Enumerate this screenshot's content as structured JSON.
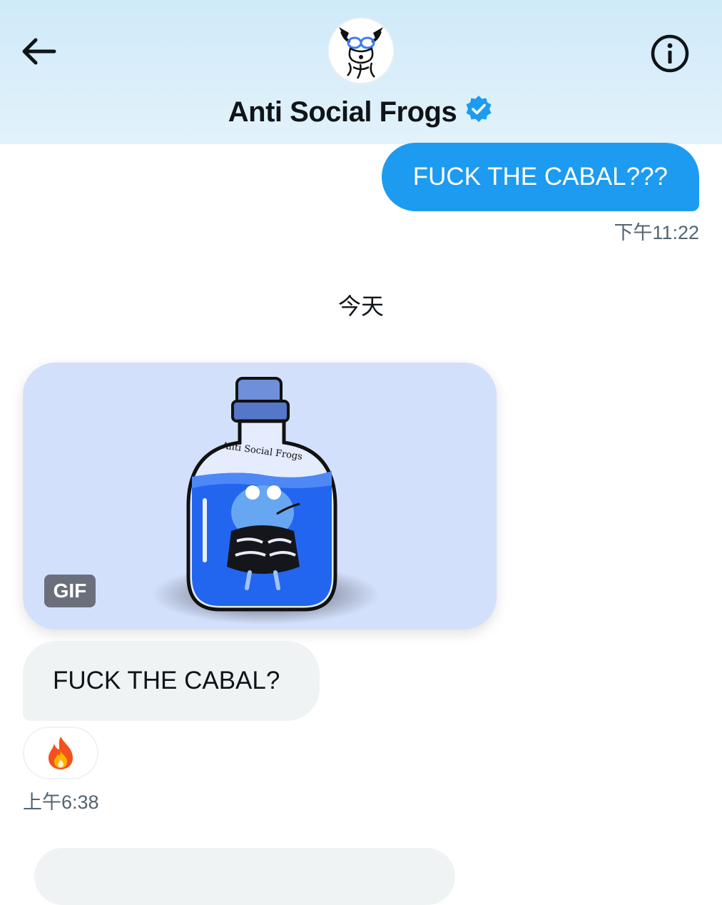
{
  "header": {
    "back_icon": "arrow-left-icon",
    "info_icon": "info-circle-icon",
    "contact_name": "Anti Social Frogs",
    "verified_icon": "verified-badge-icon",
    "accent_color": "#1d9bf0"
  },
  "conversation": {
    "outgoing": {
      "text": "FUCK THE CABAL???",
      "time": "下午11:22"
    },
    "day_separator": "今天",
    "incoming_gif": {
      "badge": "GIF",
      "image_text": "Anti Social Frogs"
    },
    "incoming_text": {
      "text": "FUCK THE CABAL?"
    },
    "reaction": {
      "emoji": "🔥"
    },
    "incoming_time": "上午6:38"
  }
}
